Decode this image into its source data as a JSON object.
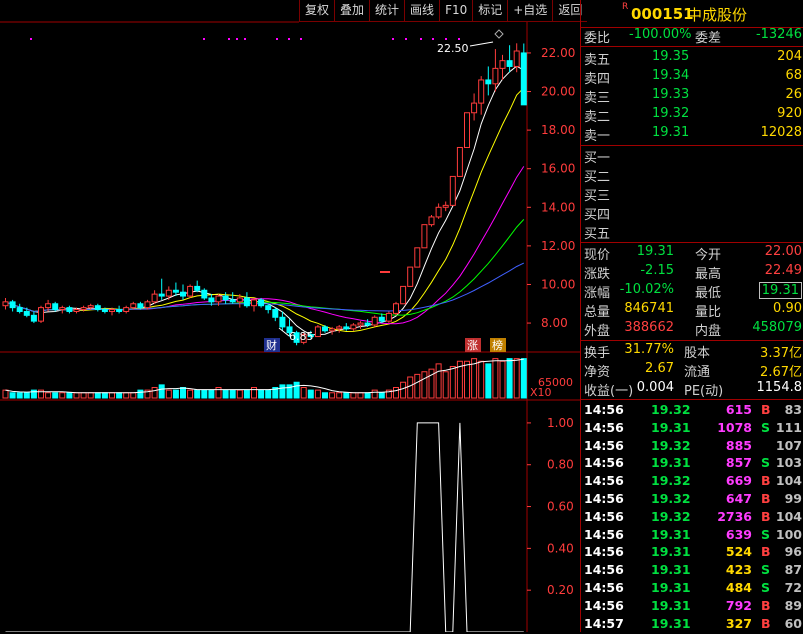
{
  "toolbar": [
    "复权",
    "叠加",
    "统计",
    "画线",
    "F10",
    "标记",
    "+自选",
    "返回"
  ],
  "stock": {
    "code": "000151",
    "name": "中成股份",
    "mark": "R"
  },
  "weibi": {
    "label": "委比",
    "value": "-100.00%",
    "label2": "委差",
    "value2": "-13246"
  },
  "asks": [
    {
      "label": "卖五",
      "price": "19.35",
      "vol": "204"
    },
    {
      "label": "卖四",
      "price": "19.34",
      "vol": "68"
    },
    {
      "label": "卖三",
      "price": "19.33",
      "vol": "26"
    },
    {
      "label": "卖二",
      "price": "19.32",
      "vol": "920"
    },
    {
      "label": "卖一",
      "price": "19.31",
      "vol": "12028"
    }
  ],
  "bids": [
    {
      "label": "买一"
    },
    {
      "label": "买二"
    },
    {
      "label": "买三"
    },
    {
      "label": "买四"
    },
    {
      "label": "买五"
    }
  ],
  "quote": [
    {
      "l1": "现价",
      "v1": "19.31",
      "l2": "今开",
      "v2": "22.00"
    },
    {
      "l1": "涨跌",
      "v1": "-2.15",
      "l2": "最高",
      "v2": "22.49"
    },
    {
      "l1": "涨幅",
      "v1": "-10.02%",
      "l2": "最低",
      "v2": "19.31"
    },
    {
      "l1": "总量",
      "v1": "846741",
      "l2": "量比",
      "v2": "0.90"
    },
    {
      "l1": "外盘",
      "v1": "388662",
      "l2": "内盘",
      "v2": "458079"
    }
  ],
  "extra": [
    {
      "l1": "换手",
      "v1": "31.77%",
      "l2": "股本",
      "v2": "3.37亿"
    },
    {
      "l1": "净资",
      "v1": "2.67",
      "l2": "流通",
      "v2": "2.67亿"
    },
    {
      "l1": "收益(一)",
      "v1": "0.004",
      "l2": "PE(动)",
      "v2": "1154.8"
    }
  ],
  "ticks": [
    {
      "t": "14:56",
      "p": "19.32",
      "v": "615",
      "bs": "B",
      "n": "83"
    },
    {
      "t": "14:56",
      "p": "19.31",
      "v": "1078",
      "bs": "S",
      "n": "111"
    },
    {
      "t": "14:56",
      "p": "19.32",
      "v": "885",
      "bs": "",
      "n": "107"
    },
    {
      "t": "14:56",
      "p": "19.31",
      "v": "857",
      "bs": "S",
      "n": "103"
    },
    {
      "t": "14:56",
      "p": "19.32",
      "v": "669",
      "bs": "B",
      "n": "104"
    },
    {
      "t": "14:56",
      "p": "19.32",
      "v": "647",
      "bs": "B",
      "n": "99"
    },
    {
      "t": "14:56",
      "p": "19.32",
      "v": "2736",
      "bs": "B",
      "n": "104"
    },
    {
      "t": "14:56",
      "p": "19.31",
      "v": "639",
      "bs": "S",
      "n": "100"
    },
    {
      "t": "14:56",
      "p": "19.31",
      "v": "524",
      "bs": "B",
      "n": "96"
    },
    {
      "t": "14:56",
      "p": "19.31",
      "v": "423",
      "bs": "S",
      "n": "87"
    },
    {
      "t": "14:56",
      "p": "19.31",
      "v": "484",
      "bs": "S",
      "n": "72"
    },
    {
      "t": "14:56",
      "p": "19.31",
      "v": "792",
      "bs": "B",
      "n": "89"
    },
    {
      "t": "14:57",
      "p": "19.31",
      "v": "327",
      "bs": "B",
      "n": "60"
    }
  ],
  "colors": {
    "up": "#ff3c3c",
    "down": "#00ffff",
    "grid": "#a00000",
    "axis": "#ff3c3c"
  },
  "chart_data": [
    {
      "type": "candlestick",
      "ylim": [
        6.5,
        23.5
      ],
      "yticks": [
        "22.00",
        "20.00",
        "18.00",
        "16.00",
        "14.00",
        "12.00",
        "10.00",
        "8.00"
      ],
      "annotations": {
        "high": "22.50",
        "low": "6.85",
        "badge1": "财",
        "badge2": "涨",
        "badge3": "榜"
      },
      "ohlc": [
        [
          8.9,
          9.3,
          8.7,
          9.1
        ],
        [
          9.1,
          9.2,
          8.6,
          8.8
        ],
        [
          8.8,
          9.0,
          8.5,
          8.6
        ],
        [
          8.6,
          8.8,
          8.3,
          8.4
        ],
        [
          8.4,
          8.6,
          8.0,
          8.1
        ],
        [
          8.1,
          8.9,
          8.0,
          8.8
        ],
        [
          8.8,
          9.2,
          8.6,
          9.0
        ],
        [
          9.0,
          9.1,
          8.6,
          8.7
        ],
        [
          8.7,
          8.9,
          8.5,
          8.8
        ],
        [
          8.8,
          8.9,
          8.5,
          8.6
        ],
        [
          8.6,
          8.8,
          8.5,
          8.7
        ],
        [
          8.7,
          8.9,
          8.6,
          8.8
        ],
        [
          8.8,
          9.0,
          8.7,
          8.9
        ],
        [
          8.9,
          9.0,
          8.6,
          8.7
        ],
        [
          8.7,
          8.8,
          8.5,
          8.6
        ],
        [
          8.6,
          8.8,
          8.4,
          8.7
        ],
        [
          8.7,
          8.9,
          8.5,
          8.6
        ],
        [
          8.6,
          8.9,
          8.5,
          8.8
        ],
        [
          8.8,
          9.1,
          8.7,
          9.0
        ],
        [
          9.0,
          9.1,
          8.7,
          8.8
        ],
        [
          8.8,
          9.2,
          8.7,
          9.1
        ],
        [
          9.1,
          9.7,
          9.0,
          9.5
        ],
        [
          9.5,
          10.3,
          9.2,
          9.4
        ],
        [
          9.4,
          9.9,
          9.2,
          9.7
        ],
        [
          9.7,
          10.1,
          9.4,
          9.6
        ],
        [
          9.6,
          10.0,
          9.2,
          9.4
        ],
        [
          9.4,
          10.0,
          9.3,
          9.9
        ],
        [
          9.9,
          10.2,
          9.6,
          9.7
        ],
        [
          9.7,
          9.8,
          9.2,
          9.3
        ],
        [
          9.3,
          9.5,
          8.9,
          9.1
        ],
        [
          9.1,
          9.5,
          8.9,
          9.4
        ],
        [
          9.4,
          9.6,
          9.0,
          9.2
        ],
        [
          9.2,
          9.6,
          9.0,
          9.1
        ],
        [
          9.1,
          9.5,
          8.8,
          9.3
        ],
        [
          9.3,
          9.6,
          8.8,
          8.9
        ],
        [
          8.9,
          9.3,
          8.6,
          9.2
        ],
        [
          9.2,
          9.3,
          8.8,
          8.9
        ],
        [
          8.9,
          9.0,
          8.5,
          8.7
        ],
        [
          8.7,
          8.8,
          8.1,
          8.3
        ],
        [
          8.3,
          8.6,
          7.6,
          7.8
        ],
        [
          7.8,
          8.2,
          7.3,
          7.5
        ],
        [
          7.5,
          7.6,
          6.85,
          7.0
        ],
        [
          7.0,
          7.5,
          6.9,
          7.4
        ],
        [
          7.4,
          7.6,
          7.2,
          7.3
        ],
        [
          7.3,
          7.9,
          7.3,
          7.8
        ],
        [
          7.8,
          7.9,
          7.5,
          7.6
        ],
        [
          7.6,
          7.8,
          7.4,
          7.7
        ],
        [
          7.7,
          7.9,
          7.5,
          7.8
        ],
        [
          7.8,
          8.0,
          7.6,
          7.7
        ],
        [
          7.7,
          8.0,
          7.6,
          7.9
        ],
        [
          7.9,
          8.1,
          7.7,
          8.0
        ],
        [
          8.0,
          8.2,
          7.8,
          7.9
        ],
        [
          7.9,
          8.4,
          7.8,
          8.3
        ],
        [
          8.3,
          8.5,
          8.0,
          8.1
        ],
        [
          8.1,
          8.6,
          8.0,
          8.5
        ],
        [
          8.5,
          9.1,
          8.4,
          9.0
        ],
        [
          9.0,
          9.9,
          9.0,
          9.9
        ],
        [
          9.9,
          10.9,
          9.9,
          10.9
        ],
        [
          10.9,
          11.9,
          10.9,
          11.9
        ],
        [
          11.9,
          13.1,
          11.9,
          13.1
        ],
        [
          13.1,
          13.6,
          13.0,
          13.5
        ],
        [
          13.5,
          14.2,
          13.4,
          14.0
        ],
        [
          14.0,
          14.3,
          13.8,
          14.1
        ],
        [
          14.1,
          15.6,
          14.1,
          15.6
        ],
        [
          15.6,
          17.1,
          15.6,
          17.1
        ],
        [
          17.1,
          18.9,
          17.1,
          18.9
        ],
        [
          18.9,
          19.9,
          18.5,
          19.4
        ],
        [
          19.4,
          20.8,
          18.8,
          20.6
        ],
        [
          20.6,
          21.3,
          19.8,
          20.4
        ],
        [
          20.4,
          22.2,
          20.0,
          21.2
        ],
        [
          21.2,
          21.9,
          20.6,
          21.6
        ],
        [
          21.6,
          22.4,
          21.0,
          21.3
        ],
        [
          21.3,
          22.5,
          21.0,
          22.1
        ],
        [
          22.0,
          22.49,
          19.31,
          19.31
        ]
      ],
      "volume": [
        3,
        2,
        2,
        2,
        3,
        3,
        2,
        2,
        2,
        2,
        2,
        2,
        2,
        2,
        2,
        2,
        2,
        2,
        2,
        3,
        3,
        4,
        5,
        3,
        3,
        4,
        3,
        3,
        3,
        3,
        4,
        3,
        3,
        3,
        3,
        4,
        3,
        3,
        4,
        5,
        5,
        6,
        4,
        3,
        3,
        2,
        2,
        2,
        2,
        2,
        2,
        2,
        3,
        2,
        3,
        4,
        6,
        8,
        9,
        10,
        11,
        13,
        10,
        12,
        14,
        14,
        15,
        14,
        13,
        15,
        14,
        15,
        15,
        15
      ],
      "volume_label": "65000",
      "volume_unit": "X10",
      "sub_ylim": [
        0,
        1.1
      ],
      "sub_yticks": [
        "1.00",
        "0.80",
        "0.60",
        "0.40",
        "0.20"
      ],
      "indicator": [
        0,
        0,
        0,
        0,
        0,
        0,
        0,
        0,
        0,
        0,
        0,
        0,
        0,
        0,
        0,
        0,
        0,
        0,
        0,
        0,
        0,
        0,
        0,
        0,
        0,
        0,
        0,
        0,
        0,
        0,
        0,
        0,
        0,
        0,
        0,
        0,
        0,
        0,
        0,
        0,
        0,
        0,
        0,
        0,
        0,
        0,
        0,
        0,
        0,
        0,
        0,
        0,
        0,
        0,
        0,
        0,
        0,
        0,
        1,
        1,
        1,
        1,
        0,
        0,
        1,
        0,
        0,
        0,
        0,
        0,
        0,
        0,
        0,
        0
      ]
    }
  ]
}
